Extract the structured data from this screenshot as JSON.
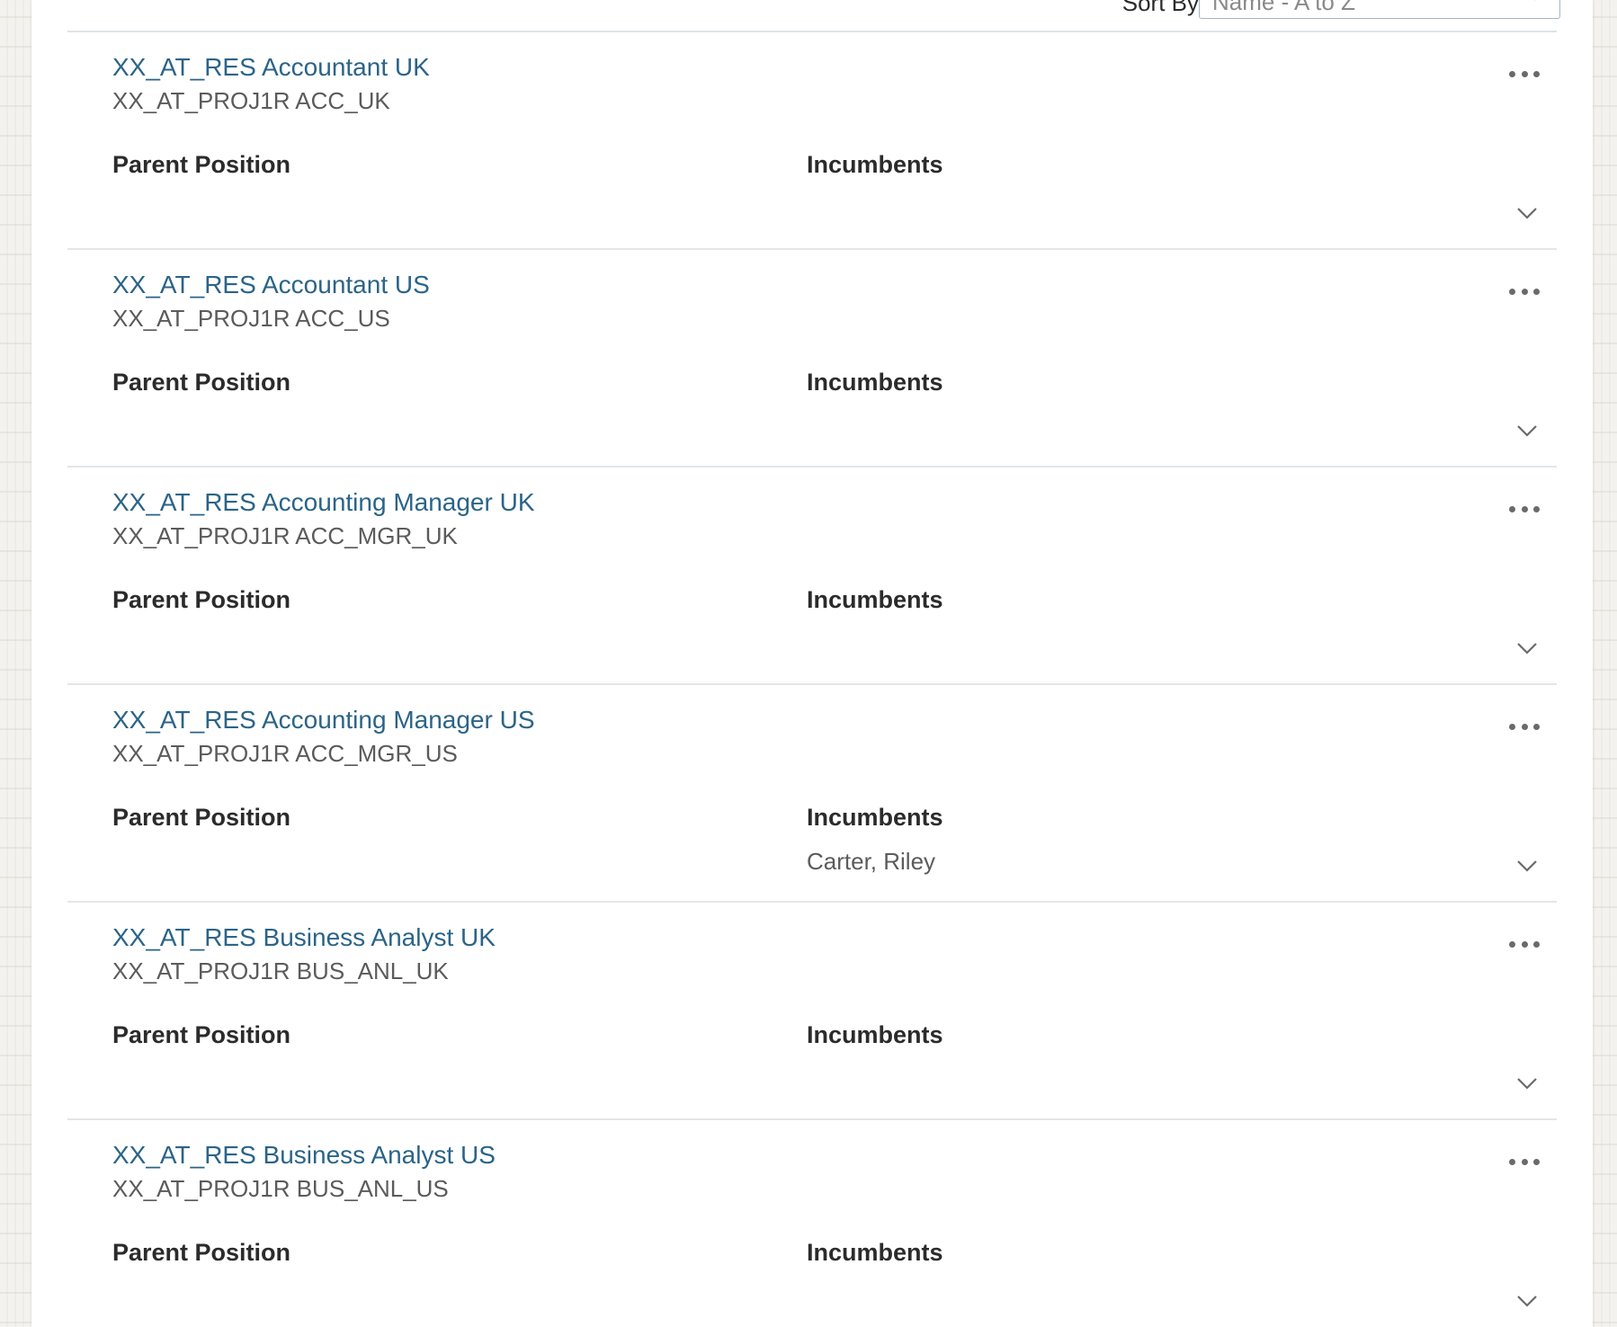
{
  "sort": {
    "label": "Sort By",
    "value": "Name - A to Z"
  },
  "labels": {
    "parent_position": "Parent Position",
    "incumbents": "Incumbents"
  },
  "positions": [
    {
      "title": "XX_AT_RES Accountant UK",
      "code": "XX_AT_PROJ1R ACC_UK",
      "incumbent": ""
    },
    {
      "title": "XX_AT_RES Accountant US",
      "code": "XX_AT_PROJ1R ACC_US",
      "incumbent": ""
    },
    {
      "title": "XX_AT_RES Accounting Manager UK",
      "code": "XX_AT_PROJ1R ACC_MGR_UK",
      "incumbent": ""
    },
    {
      "title": "XX_AT_RES Accounting Manager US",
      "code": "XX_AT_PROJ1R ACC_MGR_US",
      "incumbent": "Carter, Riley"
    },
    {
      "title": "XX_AT_RES Business Analyst UK",
      "code": "XX_AT_PROJ1R BUS_ANL_UK",
      "incumbent": ""
    },
    {
      "title": "XX_AT_RES Business Analyst US",
      "code": "XX_AT_PROJ1R BUS_ANL_US",
      "incumbent": ""
    }
  ],
  "colors": {
    "link": "#2b6488",
    "text_secondary": "#5b5b5b",
    "divider": "#e3e6e9"
  },
  "icons": {
    "more": "more-horizontal-icon",
    "expand": "chevron-down-icon"
  }
}
